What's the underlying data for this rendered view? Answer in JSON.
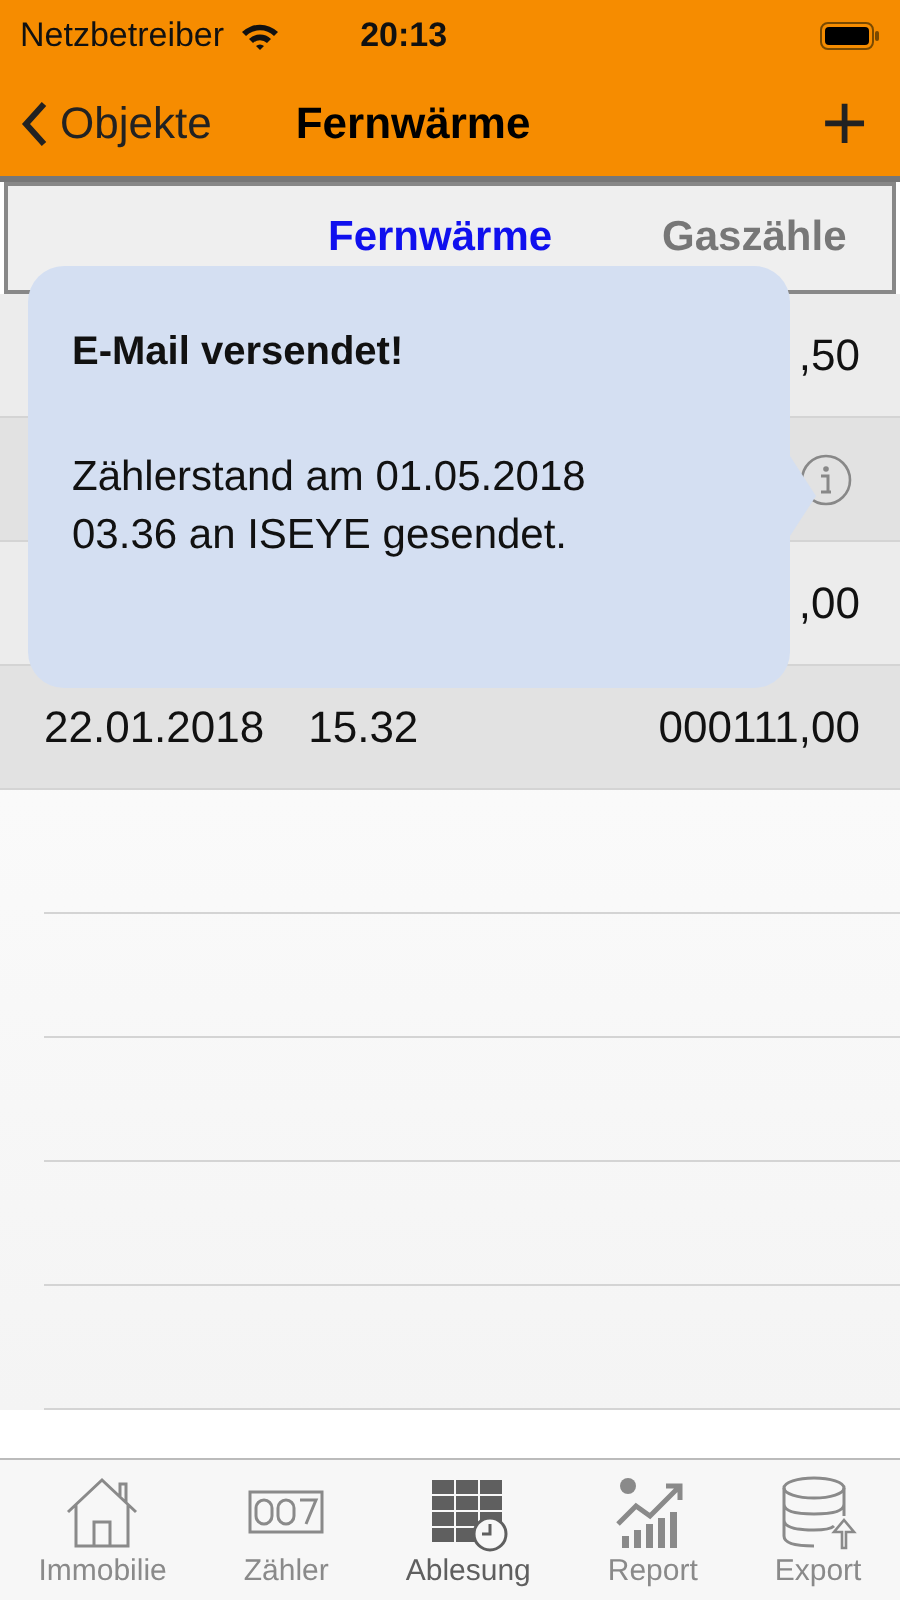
{
  "status_bar": {
    "carrier": "Netzbetreiber",
    "time": "20:13"
  },
  "nav": {
    "back": "Objekte",
    "title": "Fernwärme",
    "add": "+"
  },
  "segments": [
    {
      "label": "Fernwärme",
      "selected": true
    },
    {
      "label": "Gaszähle",
      "selected": false
    }
  ],
  "rows": [
    {
      "date": "",
      "time": "",
      "value": ",50",
      "info": false
    },
    {
      "date": "",
      "time": "",
      "value": "",
      "info": true
    },
    {
      "date": "",
      "time": "",
      "value": ",00",
      "info": false
    },
    {
      "date": "22.01.2018",
      "time": "15.32",
      "value": "000111,00",
      "info": false
    }
  ],
  "popup": {
    "title": "E-Mail versendet!",
    "message": "Zählerstand am 01.05.2018 03.36 an ISEYE gesendet."
  },
  "tab_bar": [
    {
      "label": "Immobilie",
      "kind": "house",
      "selected": false
    },
    {
      "label": "Zähler",
      "kind": "counter",
      "selected": false
    },
    {
      "label": "Ablesung",
      "kind": "table",
      "selected": true
    },
    {
      "label": "Report",
      "kind": "chart",
      "selected": false
    },
    {
      "label": "Export",
      "kind": "database",
      "selected": false
    }
  ]
}
